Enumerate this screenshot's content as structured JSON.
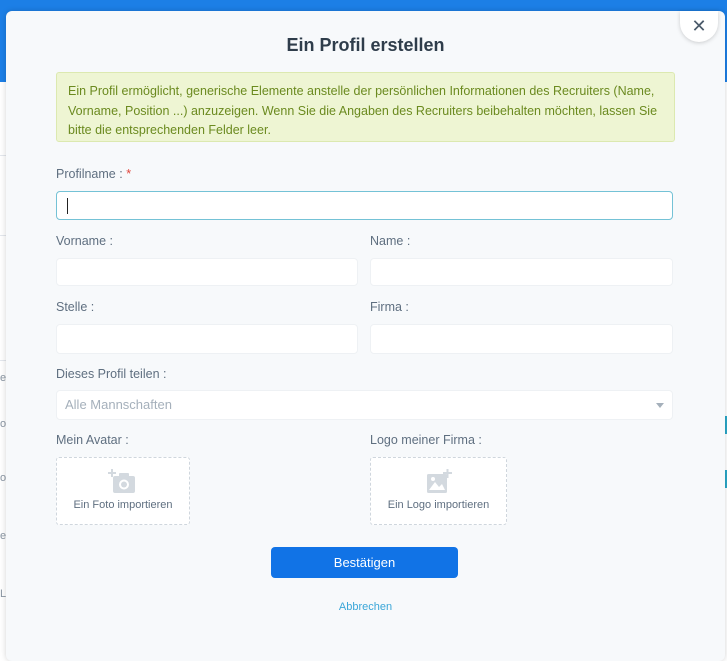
{
  "modal": {
    "title": "Ein Profil erstellen",
    "close_symbol": "✕",
    "info_text": "Ein Profil ermöglicht, generische Elemente anstelle der persönlichen Informationen des Recruiters (Name, Vorname, Position ...) anzuzeigen. Wenn Sie die Angaben des Recruiters beibehalten möchten, lassen Sie bitte die entsprechenden Felder leer.",
    "fields": {
      "profile_name": {
        "label": "Profilname :",
        "required_marker": "*",
        "value": ""
      },
      "first_name": {
        "label": "Vorname :",
        "value": ""
      },
      "name": {
        "label": "Name :",
        "value": ""
      },
      "position": {
        "label": "Stelle :",
        "value": ""
      },
      "company": {
        "label": "Firma :",
        "value": ""
      }
    },
    "share": {
      "label": "Dieses Profil teilen :",
      "selected": "Alle Mannschaften"
    },
    "avatar": {
      "label": "Mein Avatar :",
      "button": "Ein Foto importieren",
      "icon": "camera-add-icon"
    },
    "logo": {
      "label": "Logo meiner Firma :",
      "button": "Ein Logo importieren",
      "icon": "image-add-icon"
    },
    "confirm_label": "Bestätigen",
    "cancel_label": "Abbrechen"
  },
  "background": {
    "fragments": [
      "es",
      "of",
      "of",
      "e",
      "L"
    ]
  },
  "colors": {
    "primary": "#1173e6",
    "header": "#1c7fe6",
    "info_bg": "#eef5d3",
    "info_text": "#6b8a1f",
    "required": "#e0453c",
    "link": "#3aa6d8",
    "focus_border": "#74c2d6"
  }
}
